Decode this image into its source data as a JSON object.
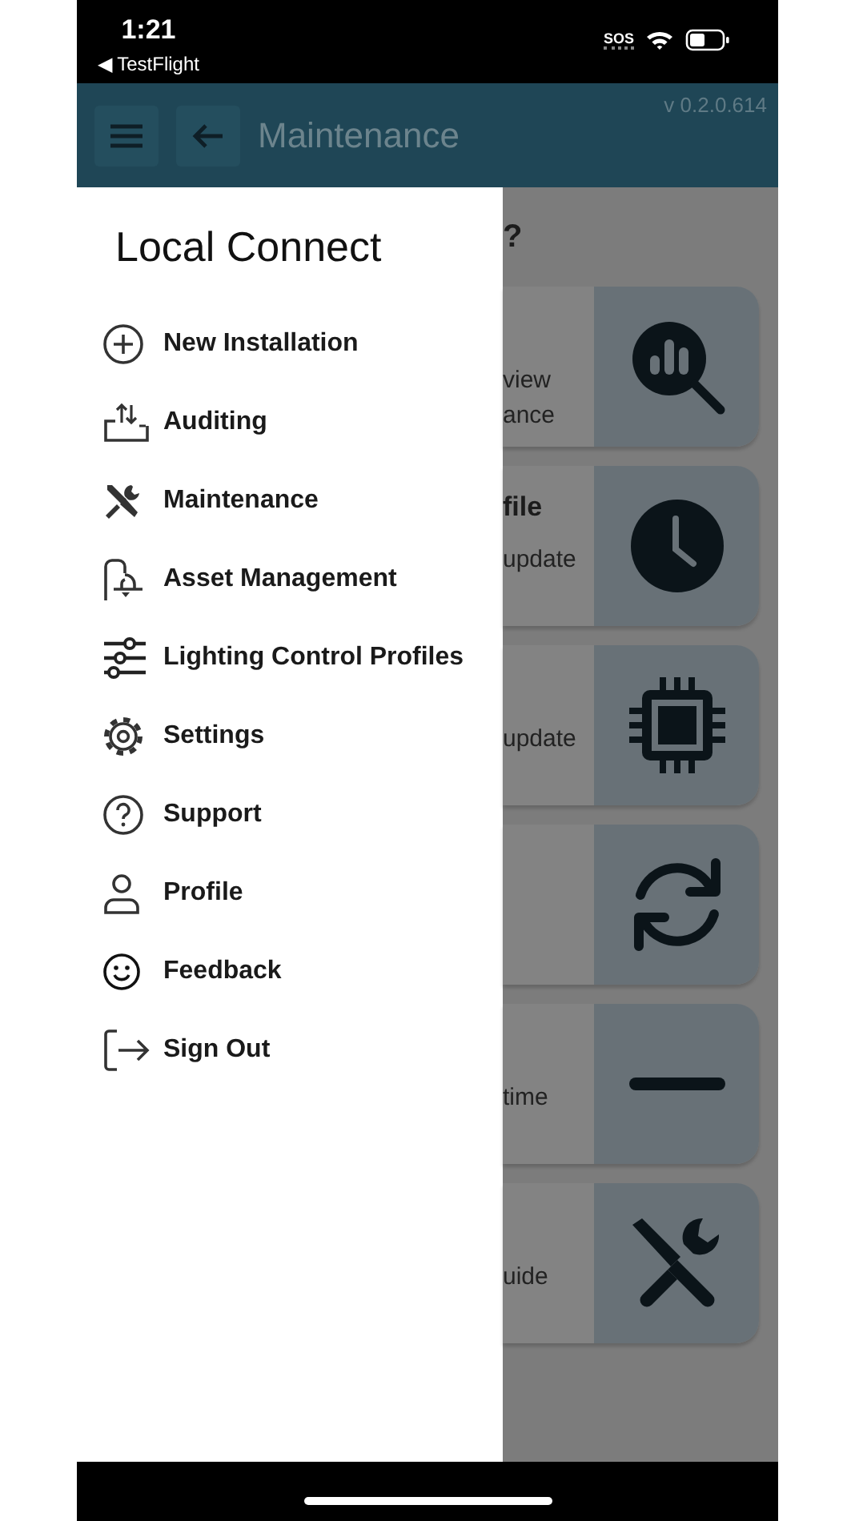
{
  "status_bar": {
    "time": "1:21",
    "back_link": "◀ TestFlight",
    "carrier": "SOS"
  },
  "header": {
    "title": "Maintenance",
    "version": "v 0.2.0.614"
  },
  "drawer": {
    "title": "Local Connect",
    "items": [
      {
        "kind": "add",
        "label": "New Installation"
      },
      {
        "kind": "audit",
        "label": "Auditing"
      },
      {
        "kind": "tools",
        "label": "Maintenance"
      },
      {
        "kind": "lamp",
        "label": "Asset Management"
      },
      {
        "kind": "sliders",
        "label": "Lighting Control Profiles"
      },
      {
        "kind": "gear",
        "label": "Settings"
      },
      {
        "kind": "help",
        "label": "Support"
      },
      {
        "kind": "person",
        "label": "Profile"
      },
      {
        "kind": "smile",
        "label": "Feedback"
      },
      {
        "kind": "signout",
        "label": "Sign Out"
      }
    ]
  },
  "background": {
    "heading": "?",
    "cards": [
      {
        "kind": "analytics",
        "lines": [
          "view",
          "ance"
        ]
      },
      {
        "kind": "clock",
        "title": "file",
        "lines": [
          "update"
        ]
      },
      {
        "kind": "chip",
        "lines": [
          "update"
        ]
      },
      {
        "kind": "sync"
      },
      {
        "kind": "minus",
        "lines": [
          "time"
        ]
      },
      {
        "kind": "tools",
        "lines": [
          "uide"
        ]
      }
    ]
  }
}
